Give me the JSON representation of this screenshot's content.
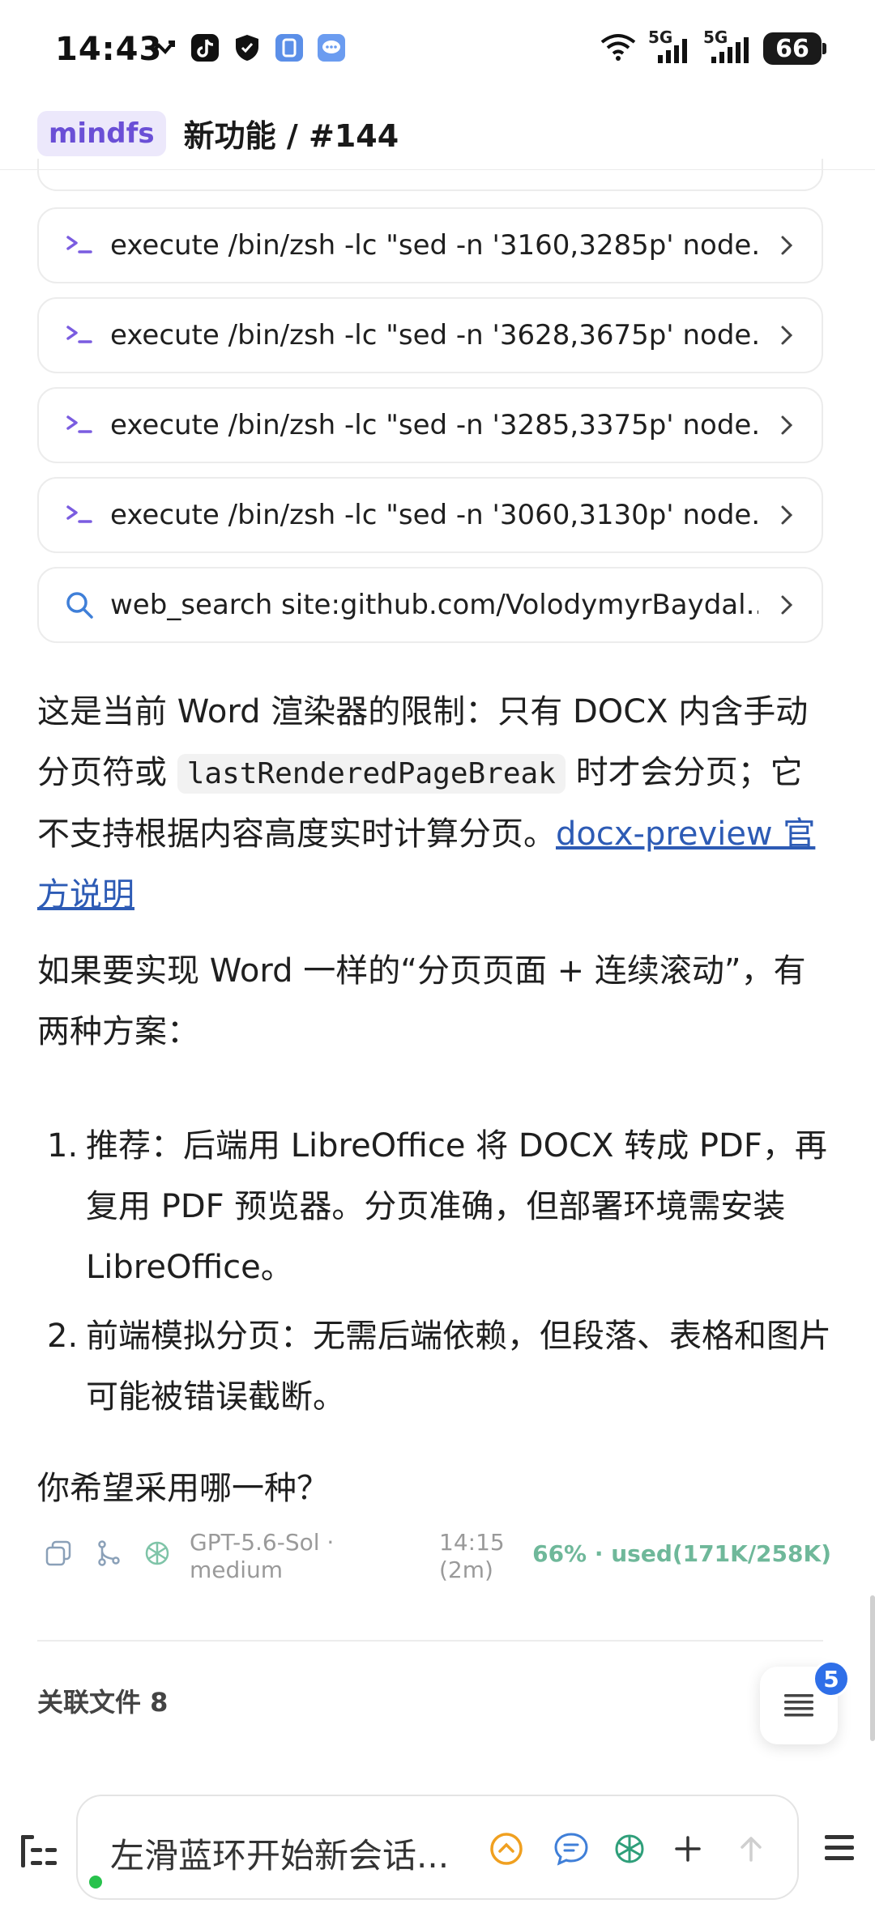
{
  "status_bar": {
    "time": "14:43",
    "network_5g_1": "5G",
    "network_5g_2": "5G",
    "battery": "66"
  },
  "header": {
    "app_badge": "mindfs",
    "title": "新功能 / #144"
  },
  "tool_calls": [
    {
      "icon": "terminal-icon",
      "label": "execute /bin/zsh -lc \"sed -n '3160,3285p' node..."
    },
    {
      "icon": "terminal-icon",
      "label": "execute /bin/zsh -lc \"sed -n '3628,3675p' node..."
    },
    {
      "icon": "terminal-icon",
      "label": "execute /bin/zsh -lc \"sed -n '3285,3375p' node..."
    },
    {
      "icon": "terminal-icon",
      "label": "execute /bin/zsh -lc \"sed -n '3060,3130p' node..."
    },
    {
      "icon": "search-icon",
      "label": "web_search site:github.com/VolodymyrBaydal..."
    }
  ],
  "message": {
    "p1_a": "这是当前 Word 渲染器的限制：只有 DOCX 内含手动分页符或 ",
    "p1_code": "lastRenderedPageBreak",
    "p1_b": " 时才会分页；它不支持根据内容高度实时计算分页。",
    "p1_link": "docx-preview 官方说明",
    "p2": "如果要实现 Word 一样的“分页页面 + 连续滚动”，有两种方案：",
    "list": [
      {
        "num": "1.",
        "text": "推荐：后端用 LibreOffice 将 DOCX 转成 PDF，再复用 PDF 预览器。分页准确，但部署环境需安装 LibreOffice。"
      },
      {
        "num": "2.",
        "text": "前端模拟分页：无需后端依赖，但段落、表格和图片可能被错误截断。"
      }
    ],
    "question": "你希望采用哪一种？"
  },
  "meta": {
    "model": "GPT-5.6-Sol · medium",
    "time": "14:15 (2m)",
    "usage": "66% · used(171K/258K)"
  },
  "related": {
    "label": "关联文件 8"
  },
  "float_badge": "5",
  "input": {
    "placeholder": "左滑蓝环开始新会话..."
  },
  "colors": {
    "accent": "#6a4fd6",
    "link": "#2d5bb5",
    "usage": "#6fb89a",
    "badge": "#2f6fe8"
  }
}
